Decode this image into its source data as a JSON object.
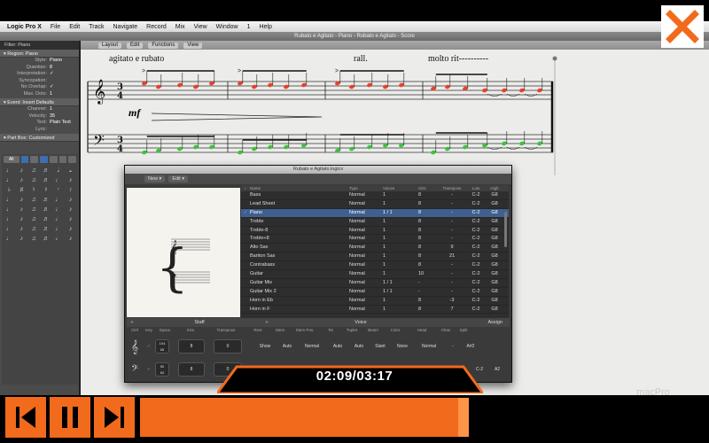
{
  "menubar": {
    "app": "Logic Pro X",
    "items": [
      "File",
      "Edit",
      "Track",
      "Navigate",
      "Record",
      "Mix",
      "View",
      "Window",
      "1",
      "Help"
    ]
  },
  "window_title": "Rubato e Agitato - Piano - Rubato e Agitato - Score",
  "inspector": {
    "filter": "Filter: Piano",
    "region_header": "Region: Piano",
    "region_rows": [
      {
        "k": "Style:",
        "v": "Piano"
      },
      {
        "k": "Quantize:",
        "v": "8"
      },
      {
        "k": "Interpretation:",
        "v": "✓"
      },
      {
        "k": "Syncopation:",
        "v": ""
      },
      {
        "k": "No Overlap:",
        "v": "✓"
      },
      {
        "k": "Max. Dots:",
        "v": "1"
      }
    ],
    "event_header": "Event: Insert Defaults",
    "event_rows": [
      {
        "k": "Channel:",
        "v": "1"
      },
      {
        "k": "Velocity:",
        "v": "35"
      },
      {
        "k": "Text:",
        "v": "Plain Text"
      },
      {
        "k": "Lyric:",
        "v": ""
      }
    ],
    "partbox_header": "Part Box: Customized",
    "partbox_tab": "All"
  },
  "score_toolbar": {
    "layout": "Layout",
    "edit": "Edit",
    "functions": "Functions",
    "view": "View"
  },
  "score": {
    "directions": [
      "agitato e rubato",
      "rall.",
      "molto rit----------"
    ],
    "dynamic": "mf",
    "time_sig": "3\n4",
    "colors": {
      "treble_notes": "#e8422a",
      "bass_notes": "#3cc43a",
      "staff": "#222"
    }
  },
  "project_window": {
    "title": "Rubato e Agitato.logicx",
    "new_label": "New",
    "edit_label": "Edit",
    "columns": [
      "✓",
      "Name",
      "Type",
      "Voices",
      "Size",
      "Transpose",
      "Low",
      "High"
    ],
    "rows": [
      {
        "chk": "",
        "name": "Bass",
        "type": "Normal",
        "voices": "1",
        "size": "8",
        "trans": "-",
        "low": "C-2",
        "high": "G8",
        "sel": false
      },
      {
        "chk": "",
        "name": "Lead Sheet",
        "type": "Normal",
        "voices": "1",
        "size": "8",
        "trans": "-",
        "low": "C-2",
        "high": "G8",
        "sel": false
      },
      {
        "chk": "✓",
        "name": "Piano",
        "type": "Normal",
        "voices": "1 / 1",
        "size": "8",
        "trans": "-",
        "low": "C-2",
        "high": "G8",
        "sel": true
      },
      {
        "chk": "",
        "name": "Treble",
        "type": "Normal",
        "voices": "1",
        "size": "8",
        "trans": "-",
        "low": "C-2",
        "high": "G8",
        "sel": false
      },
      {
        "chk": "",
        "name": "Treble-8",
        "type": "Normal",
        "voices": "1",
        "size": "8",
        "trans": "-",
        "low": "C-2",
        "high": "G8",
        "sel": false
      },
      {
        "chk": "",
        "name": "Treble+8",
        "type": "Normal",
        "voices": "1",
        "size": "8",
        "trans": "-",
        "low": "C-2",
        "high": "G8",
        "sel": false
      },
      {
        "chk": "",
        "name": "Alto Sax",
        "type": "Normal",
        "voices": "1",
        "size": "8",
        "trans": "9",
        "low": "C-2",
        "high": "G8",
        "sel": false
      },
      {
        "chk": "",
        "name": "Bariton Sax",
        "type": "Normal",
        "voices": "1",
        "size": "8",
        "trans": "21",
        "low": "C-2",
        "high": "G8",
        "sel": false
      },
      {
        "chk": "",
        "name": "Contrabass",
        "type": "Normal",
        "voices": "1",
        "size": "8",
        "trans": "-",
        "low": "C-2",
        "high": "G8",
        "sel": false
      },
      {
        "chk": "",
        "name": "Guitar",
        "type": "Normal",
        "voices": "1",
        "size": "10",
        "trans": "-",
        "low": "C-2",
        "high": "G8",
        "sel": false
      },
      {
        "chk": "",
        "name": "Guitar Mix",
        "type": "Normal",
        "voices": "1 / 1",
        "size": "-",
        "trans": "-",
        "low": "C-2",
        "high": "G8",
        "sel": false
      },
      {
        "chk": "",
        "name": "Guitar Mix 2",
        "type": "Normal",
        "voices": "1 / 1",
        "size": "-",
        "trans": "-",
        "low": "C-2",
        "high": "G8",
        "sel": false
      },
      {
        "chk": "",
        "name": "Horn in Eb",
        "type": "Normal",
        "voices": "1",
        "size": "8",
        "trans": "-3",
        "low": "C-2",
        "high": "G8",
        "sel": false
      },
      {
        "chk": "",
        "name": "Horn in F",
        "type": "Normal",
        "voices": "1",
        "size": "8",
        "trans": "7",
        "low": "C-2",
        "high": "G8",
        "sel": false
      }
    ],
    "split": {
      "staff": "Staff",
      "voice": "Voice",
      "assign": "Assign"
    },
    "staff_columns": [
      "Clef",
      "Key",
      "Space",
      "Size",
      "Transpose",
      "Rest",
      "Stem",
      "Stem Pos.",
      "Tie",
      "Tuplet",
      "Beam",
      "Color",
      "Head",
      "Chan",
      "Split"
    ],
    "staff_rows": [
      {
        "space_top": "104",
        "space_bot": "65",
        "size": "8",
        "transpose": "0",
        "rest": "Show",
        "stem": "Auto",
        "stem_pos": "Normal",
        "tie": "Auto",
        "tuplet": "Auto",
        "beam": "Slant",
        "color": "None",
        "head": "Normal",
        "chan": "-",
        "split": "A#2"
      },
      {
        "space_top": "50",
        "space_bot": "60",
        "size": "8",
        "transpose": "0",
        "chan": "C-2",
        "split": "A2"
      }
    ]
  },
  "video": {
    "time": "02:09/03:17",
    "progress": 0.66,
    "accent": "#f26a1b",
    "watermark": "macPro"
  }
}
